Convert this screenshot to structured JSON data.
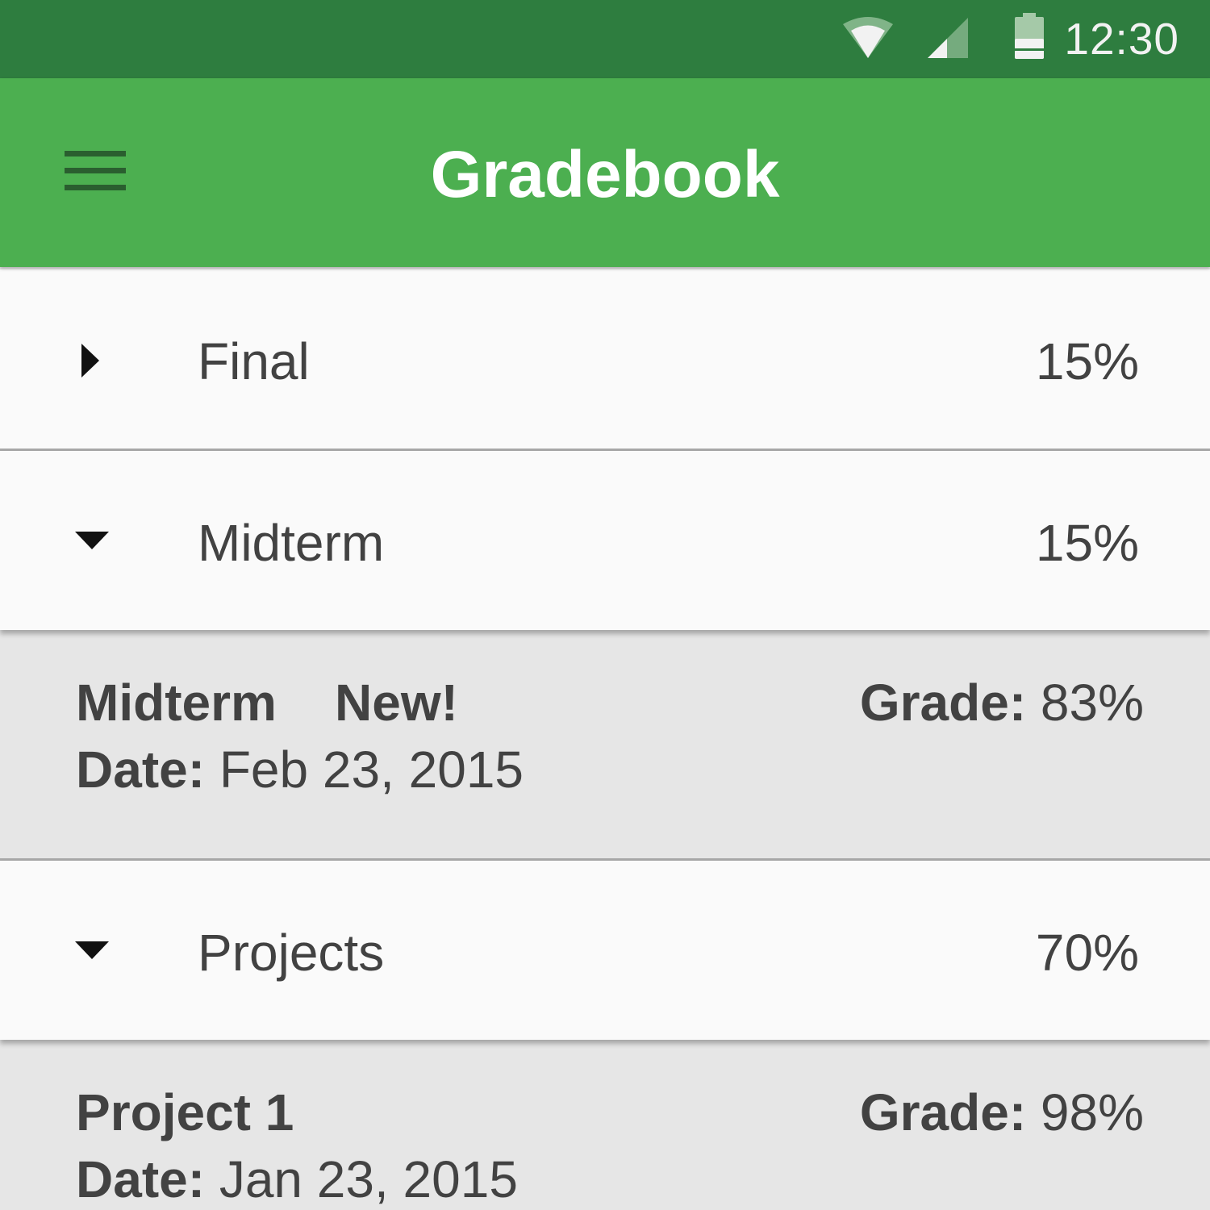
{
  "status_bar": {
    "time": "12:30",
    "icons": [
      "wifi-icon",
      "cell-signal-icon",
      "battery-icon"
    ],
    "color": "#2e7d3f"
  },
  "app_bar": {
    "title": "Gradebook",
    "menu_icon": "hamburger-menu-icon",
    "color": "#4caf50"
  },
  "categories": [
    {
      "name": "Final",
      "weight": "15%",
      "expanded": false,
      "items": []
    },
    {
      "name": "Midterm",
      "weight": "15%",
      "expanded": true,
      "items": [
        {
          "title": "Midterm",
          "badge": "New!",
          "date_label": "Date:",
          "date": "Feb 23, 2015",
          "grade_label": "Grade:",
          "grade": "83%"
        }
      ]
    },
    {
      "name": "Projects",
      "weight": "70%",
      "expanded": true,
      "items": [
        {
          "title": "Project 1",
          "badge": "",
          "date_label": "Date:",
          "date": "Jan 23, 2015",
          "grade_label": "Grade:",
          "grade": "98%"
        }
      ]
    }
  ]
}
